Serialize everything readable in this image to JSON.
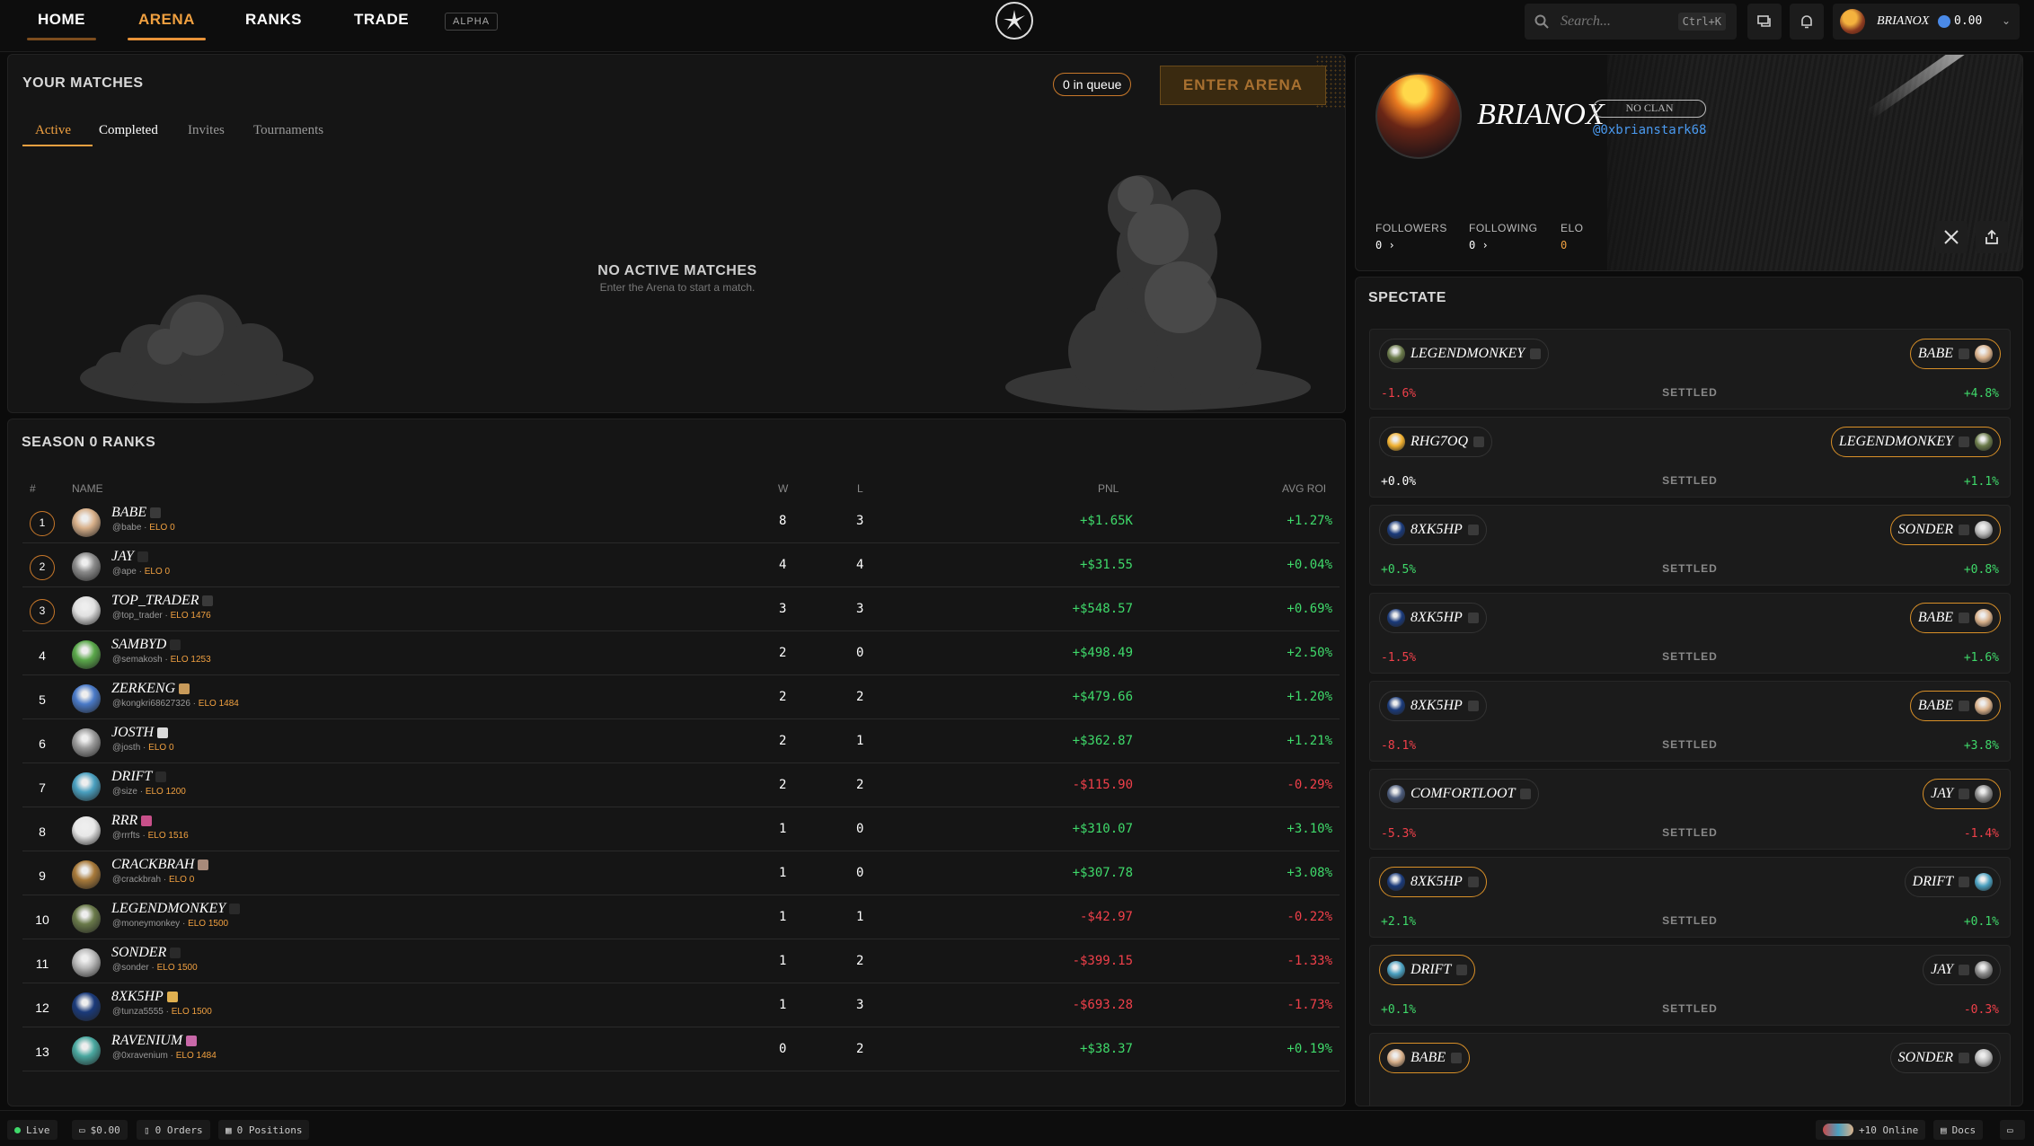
{
  "nav": {
    "tabs": [
      "HOME",
      "ARENA",
      "RANKS",
      "TRADE"
    ],
    "alpha": "ALPHA",
    "search_placeholder": "Search...",
    "search_shortcut": "Ctrl+K",
    "user": {
      "name": "BRIANOX",
      "balance": "0.00"
    }
  },
  "matches": {
    "title": "YOUR MATCHES",
    "queue": "0 in queue",
    "enter_arena": "ENTER ARENA",
    "tabs": [
      "Active",
      "Completed",
      "Invites",
      "Tournaments"
    ],
    "empty_title": "NO ACTIVE MATCHES",
    "empty_sub": "Enter the Arena to start a match."
  },
  "ranks": {
    "title": "SEASON 0 RANKS",
    "headers": {
      "rank": "#",
      "name": "NAME",
      "w": "W",
      "l": "L",
      "pnl": "PNL",
      "roi": "AVG ROI"
    },
    "rows": [
      {
        "rank": "1",
        "name": "BABE",
        "handle": "@babe",
        "elo": "ELO 0",
        "w": "8",
        "l": "3",
        "pnl": "+$1.65K",
        "roi": "+1.27%",
        "pnl_neg": false,
        "roi_neg": false,
        "medal": true,
        "avatar_color": "#d8b08a",
        "badge_color": "#3a3a3a"
      },
      {
        "rank": "2",
        "name": "JAY",
        "handle": "@ape",
        "elo": "ELO 0",
        "w": "4",
        "l": "4",
        "pnl": "+$31.55",
        "roi": "+0.04%",
        "pnl_neg": false,
        "roi_neg": false,
        "medal": true,
        "avatar_color": "#8a8a8a",
        "badge_color": "#2a2a2a"
      },
      {
        "rank": "3",
        "name": "TOP_TRADER",
        "handle": "@top_trader",
        "elo": "ELO 1476",
        "w": "3",
        "l": "3",
        "pnl": "+$548.57",
        "roi": "+0.69%",
        "pnl_neg": false,
        "roi_neg": false,
        "medal": true,
        "avatar_color": "#e0e0e0",
        "badge_color": "#3a3a3a"
      },
      {
        "rank": "4",
        "name": "SAMBYD",
        "handle": "@semakosh",
        "elo": "ELO 1253",
        "w": "2",
        "l": "0",
        "pnl": "+$498.49",
        "roi": "+2.50%",
        "pnl_neg": false,
        "roi_neg": false,
        "medal": false,
        "avatar_color": "#5aa84a",
        "badge_color": "#2a2a2a"
      },
      {
        "rank": "5",
        "name": "ZERKENG",
        "handle": "@kongkri68627326",
        "elo": "ELO 1484",
        "w": "2",
        "l": "2",
        "pnl": "+$479.66",
        "roi": "+1.20%",
        "pnl_neg": false,
        "roi_neg": false,
        "medal": false,
        "avatar_color": "#4a7ac8",
        "badge_color": "#c89a5a"
      },
      {
        "rank": "6",
        "name": "JOSTH",
        "handle": "@josth",
        "elo": "ELO 0",
        "w": "2",
        "l": "1",
        "pnl": "+$362.87",
        "roi": "+1.21%",
        "pnl_neg": false,
        "roi_neg": false,
        "medal": false,
        "avatar_color": "#9a9a9a",
        "badge_color": "#dadada"
      },
      {
        "rank": "7",
        "name": "DRIFT",
        "handle": "@size",
        "elo": "ELO 1200",
        "w": "2",
        "l": "2",
        "pnl": "-$115.90",
        "roi": "-0.29%",
        "pnl_neg": true,
        "roi_neg": true,
        "medal": false,
        "avatar_color": "#4aa0c0",
        "badge_color": "#2a2a2a"
      },
      {
        "rank": "8",
        "name": "RRR",
        "handle": "@rrrfts",
        "elo": "ELO 1516",
        "w": "1",
        "l": "0",
        "pnl": "+$310.07",
        "roi": "+3.10%",
        "pnl_neg": false,
        "roi_neg": false,
        "medal": false,
        "avatar_color": "#e8e8e8",
        "badge_color": "#c8508a"
      },
      {
        "rank": "9",
        "name": "CRACKBRAH",
        "handle": "@crackbrah",
        "elo": "ELO 0",
        "w": "1",
        "l": "0",
        "pnl": "+$307.78",
        "roi": "+3.08%",
        "pnl_neg": false,
        "roi_neg": false,
        "medal": false,
        "avatar_color": "#a87a3a",
        "badge_color": "#a88a7a"
      },
      {
        "rank": "10",
        "name": "LEGENDMONKEY",
        "handle": "@moneymonkey",
        "elo": "ELO 1500",
        "w": "1",
        "l": "1",
        "pnl": "-$42.97",
        "roi": "-0.22%",
        "pnl_neg": true,
        "roi_neg": true,
        "medal": false,
        "avatar_color": "#6a7a4a",
        "badge_color": "#2a2a2a"
      },
      {
        "rank": "11",
        "name": "SONDER",
        "handle": "@sonder",
        "elo": "ELO 1500",
        "w": "1",
        "l": "2",
        "pnl": "-$399.15",
        "roi": "-1.33%",
        "pnl_neg": true,
        "roi_neg": true,
        "medal": false,
        "avatar_color": "#b8b8b8",
        "badge_color": "#2a2a2a"
      },
      {
        "rank": "12",
        "name": "8XK5HP",
        "handle": "@tunza5555",
        "elo": "ELO 1500",
        "w": "1",
        "l": "3",
        "pnl": "-$693.28",
        "roi": "-1.73%",
        "pnl_neg": true,
        "roi_neg": true,
        "medal": false,
        "avatar_color": "#1a3a7a",
        "badge_color": "#e0b050"
      },
      {
        "rank": "13",
        "name": "RAVENIUM",
        "handle": "@0xravenium",
        "elo": "ELO 1484",
        "w": "0",
        "l": "2",
        "pnl": "+$38.37",
        "roi": "+0.19%",
        "pnl_neg": false,
        "roi_neg": false,
        "medal": false,
        "avatar_color": "#4aa8a0",
        "badge_color": "#c868a8"
      }
    ]
  },
  "profile": {
    "name": "BRIANOX",
    "clan": "NO CLAN",
    "handle": "@0xbrianstark68",
    "followers_label": "FOLLOWERS",
    "followers": "0 ›",
    "following_label": "FOLLOWING",
    "following": "0 ›",
    "elo_label": "ELO",
    "elo": "0"
  },
  "spectate": {
    "title": "SPECTATE",
    "cards": [
      {
        "left": "LEGENDMONKEY",
        "right": "BABE",
        "left_pct": "-1.6%",
        "right_pct": "+4.8%",
        "status": "SETTLED",
        "left_neg": true,
        "right_neg": false,
        "winner": "right",
        "left_color": "#6a7a4a",
        "right_color": "#d8b08a"
      },
      {
        "left": "RHG7OQ",
        "right": "LEGENDMONKEY",
        "left_pct": "+0.0%",
        "right_pct": "+1.1%",
        "status": "SETTLED",
        "left_neg": false,
        "left_neutral": true,
        "right_neg": false,
        "winner": "right",
        "left_color": "#f0b030",
        "right_color": "#6a7a4a"
      },
      {
        "left": "8XK5HP",
        "right": "SONDER",
        "left_pct": "+0.5%",
        "right_pct": "+0.8%",
        "status": "SETTLED",
        "left_neg": false,
        "right_neg": false,
        "winner": "right",
        "left_color": "#1a3a7a",
        "right_color": "#b8b8b8"
      },
      {
        "left": "8XK5HP",
        "right": "BABE",
        "left_pct": "-1.5%",
        "right_pct": "+1.6%",
        "status": "SETTLED",
        "left_neg": true,
        "right_neg": false,
        "winner": "right",
        "left_color": "#1a3a7a",
        "right_color": "#d8b08a"
      },
      {
        "left": "8XK5HP",
        "right": "BABE",
        "left_pct": "-8.1%",
        "right_pct": "+3.8%",
        "status": "SETTLED",
        "left_neg": true,
        "right_neg": false,
        "winner": "right",
        "left_color": "#1a3a7a",
        "right_color": "#d8b08a"
      },
      {
        "left": "COMFORTLOOT",
        "right": "JAY",
        "left_pct": "-5.3%",
        "right_pct": "-1.4%",
        "status": "SETTLED",
        "left_neg": true,
        "right_neg": true,
        "winner": "right",
        "left_color": "#4a5a7a",
        "right_color": "#8a8a8a"
      },
      {
        "left": "8XK5HP",
        "right": "DRIFT",
        "left_pct": "+2.1%",
        "right_pct": "+0.1%",
        "status": "SETTLED",
        "left_neg": false,
        "right_neg": false,
        "winner": "left",
        "left_color": "#1a3a7a",
        "right_color": "#4aa0c0"
      },
      {
        "left": "DRIFT",
        "right": "JAY",
        "left_pct": "+0.1%",
        "right_pct": "-0.3%",
        "status": "SETTLED",
        "left_neg": false,
        "right_neg": true,
        "winner": "left",
        "left_color": "#4aa0c0",
        "right_color": "#8a8a8a"
      },
      {
        "left": "BABE",
        "right": "SONDER",
        "left_pct": "",
        "right_pct": "",
        "status": "",
        "left_neg": false,
        "right_neg": false,
        "winner": "left",
        "left_color": "#d8b08a",
        "right_color": "#b8b8b8"
      }
    ]
  },
  "bottom": {
    "live": "Live",
    "cash": "$0.00",
    "orders": "0 Orders",
    "positions": "0 Positions",
    "online": "+10 Online",
    "docs": "Docs"
  },
  "colors": {
    "accent": "#f0a040",
    "positive": "#3fd96a",
    "negative": "#f0404a",
    "handle_blue": "#4a9af0"
  },
  "icons": [
    "logo-star-icon",
    "search-icon",
    "chat-icon",
    "bell-icon",
    "chevron-down-icon",
    "x-logo-icon",
    "share-icon",
    "wallet-icon",
    "orders-icon",
    "positions-icon",
    "docs-icon",
    "panel-icon"
  ]
}
